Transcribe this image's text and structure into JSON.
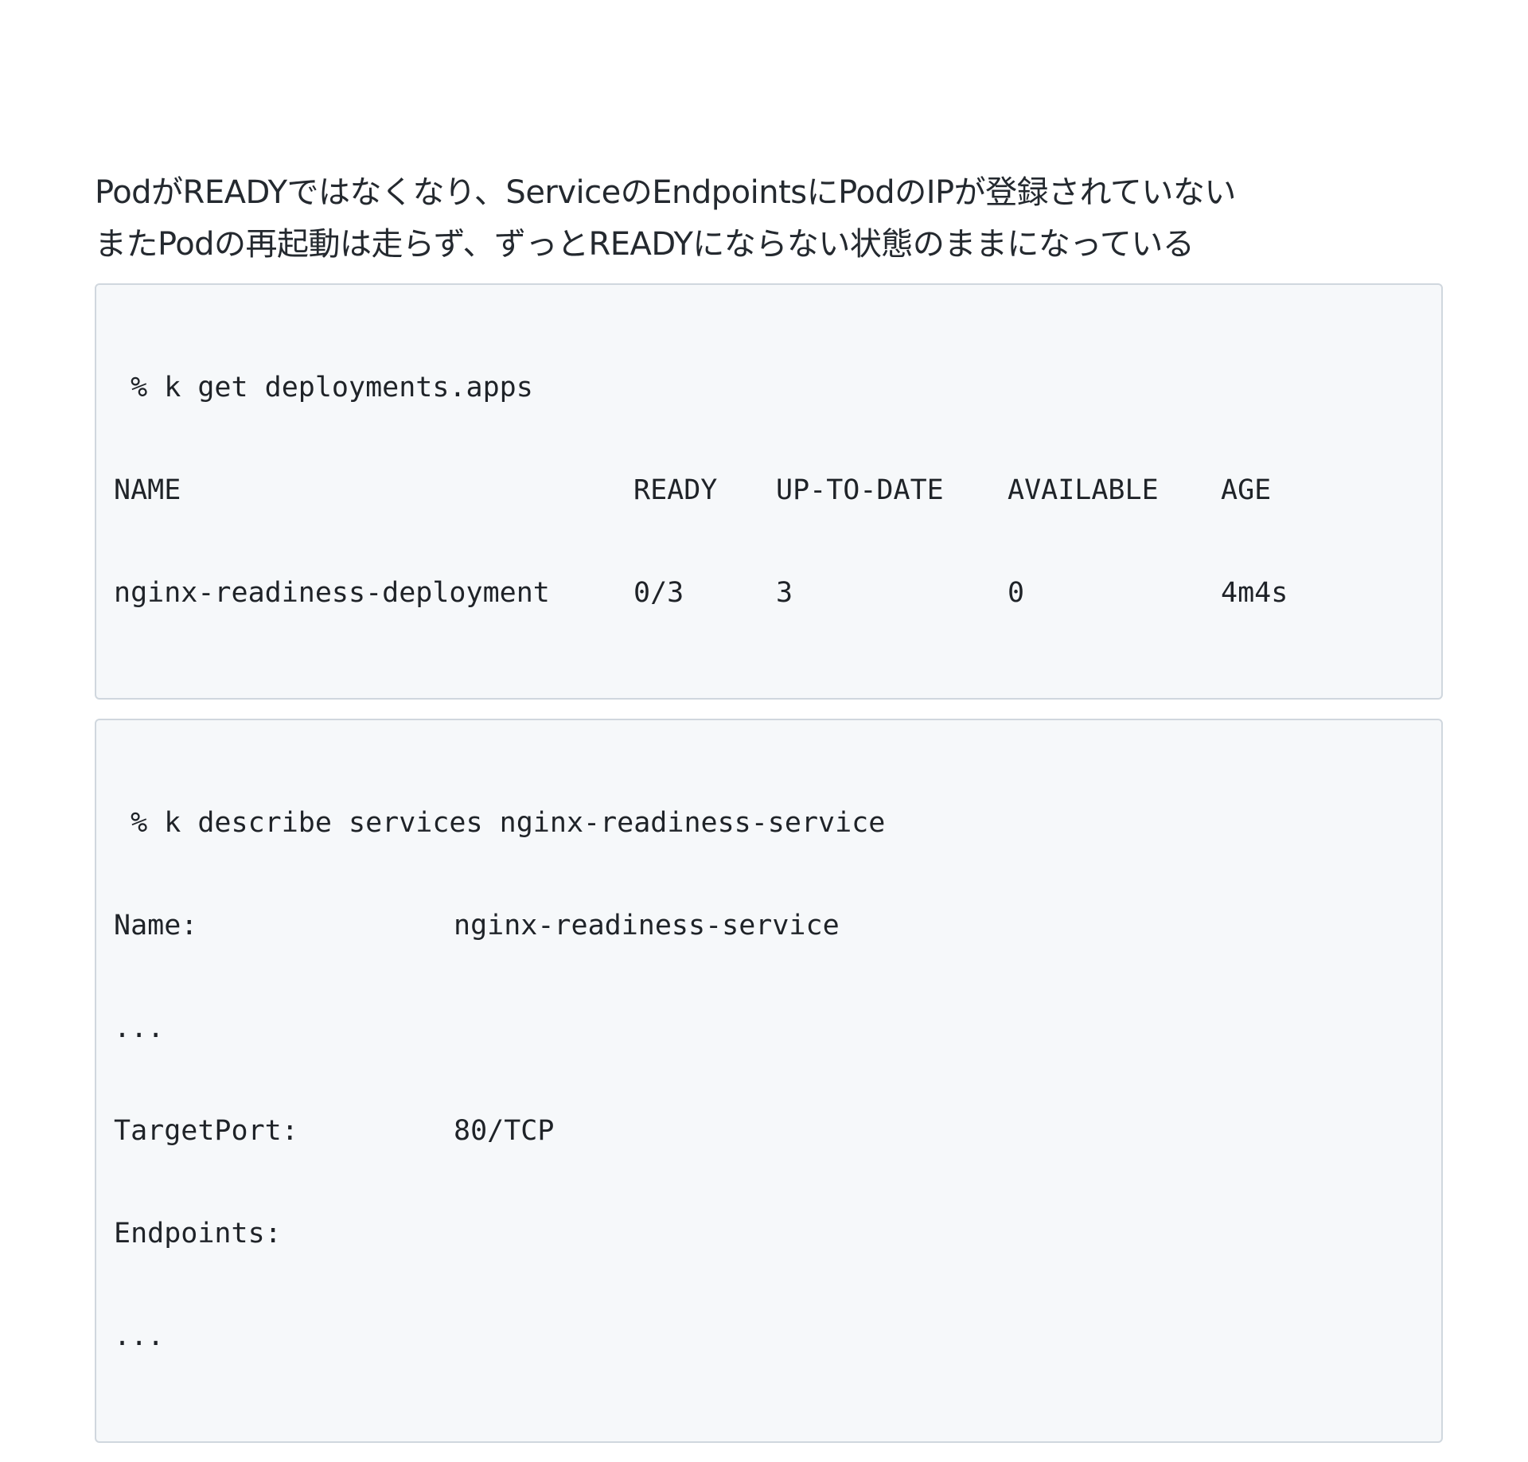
{
  "lead": {
    "line1": "PodがREADYではなくなり、ServiceのEndpointsにPodのIPが登録されていない",
    "line2": "またPodの再起動は走らず、ずっとREADYにならない状態のままになっている"
  },
  "deployments_block": {
    "command": " % k get deployments.apps",
    "headers": [
      "NAME",
      "READY",
      "UP-TO-DATE",
      "AVAILABLE",
      "AGE"
    ],
    "rows": [
      [
        "nginx-readiness-deployment",
        "0/3",
        "3",
        "0",
        "4m4s"
      ]
    ]
  },
  "service_block": {
    "command": " % k describe services nginx-readiness-service",
    "lines": [
      {
        "label": "Name:",
        "value": "nginx-readiness-service"
      },
      {
        "label": "...",
        "value": ""
      },
      {
        "label": "TargetPort:",
        "value": "80/TCP"
      },
      {
        "label": "Endpoints:",
        "value": ""
      },
      {
        "label": "...",
        "value": ""
      }
    ]
  }
}
